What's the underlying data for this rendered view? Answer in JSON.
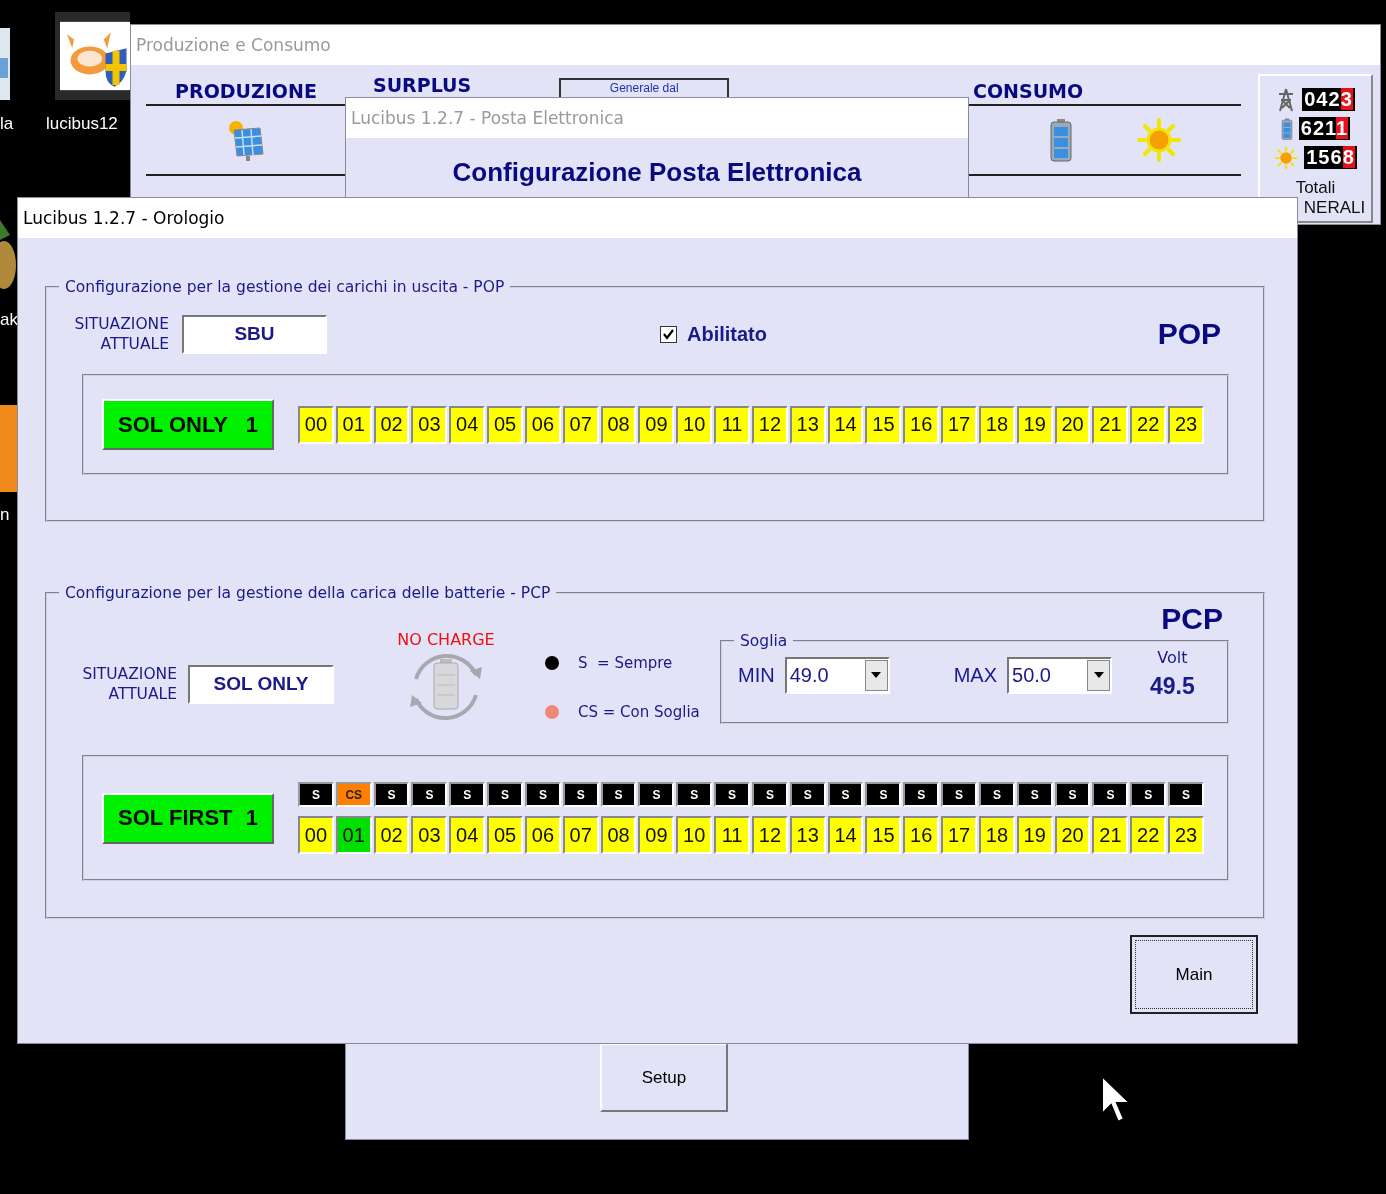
{
  "desktop": {
    "icons": [
      {
        "label": "la"
      },
      {
        "label": "lucibus12"
      },
      {
        "label": "ak"
      },
      {
        "label": "n"
      }
    ]
  },
  "produzione_window": {
    "title": "Produzione e Consumo",
    "headings": [
      "PRODUZIONE",
      "SURPLUS",
      "CONSUMO"
    ],
    "period_box": "Generale dal",
    "totals": {
      "counters": [
        {
          "kind": "grid",
          "value": "0423"
        },
        {
          "kind": "battery",
          "value": "6211"
        },
        {
          "kind": "solar",
          "value": "1568"
        }
      ],
      "label": "Totali",
      "label_2": "NERALI"
    }
  },
  "posta_window": {
    "title": "Lucibus 1.2.7 - Posta Elettronica",
    "heading": "Configurazione Posta Elettronica",
    "buttons": [
      "Setup"
    ]
  },
  "orologio_window": {
    "title": "Lucibus 1.2.7 - Orologio",
    "pop": {
      "legend": "Configurazione per la gestione dei carichi in uscita - POP",
      "status_label": "SITUAZIONE ATTUALE",
      "status_value": "SBU",
      "enabled": {
        "label": "Abilitato",
        "checked": true
      },
      "code": "POP",
      "program": {
        "label": "SOL ONLY",
        "number": "1"
      },
      "hours": [
        {
          "label": "00",
          "selected": false
        },
        {
          "label": "01",
          "selected": false
        },
        {
          "label": "02",
          "selected": false
        },
        {
          "label": "03",
          "selected": false
        },
        {
          "label": "04",
          "selected": false
        },
        {
          "label": "05",
          "selected": false
        },
        {
          "label": "06",
          "selected": false
        },
        {
          "label": "07",
          "selected": false
        },
        {
          "label": "08",
          "selected": false
        },
        {
          "label": "09",
          "selected": false
        },
        {
          "label": "10",
          "selected": false
        },
        {
          "label": "11",
          "selected": false
        },
        {
          "label": "12",
          "selected": false
        },
        {
          "label": "13",
          "selected": false
        },
        {
          "label": "14",
          "selected": false
        },
        {
          "label": "15",
          "selected": false
        },
        {
          "label": "16",
          "selected": false
        },
        {
          "label": "17",
          "selected": false
        },
        {
          "label": "18",
          "selected": false
        },
        {
          "label": "19",
          "selected": false
        },
        {
          "label": "20",
          "selected": false
        },
        {
          "label": "21",
          "selected": false
        },
        {
          "label": "22",
          "selected": false
        },
        {
          "label": "23",
          "selected": false
        }
      ]
    },
    "pcp": {
      "legend": "Configurazione per la gestione della carica delle batterie - PCP",
      "code": "PCP",
      "status_label": "SITUAZIONE ATTUALE",
      "status_value": "SOL ONLY",
      "charge_state": "NO CHARGE",
      "modes_legend": [
        {
          "label": "S  = Sempre",
          "color": "#000000"
        },
        {
          "label": "CS = Con Soglia",
          "color": "#f08878"
        }
      ],
      "threshold": {
        "legend": "Soglia",
        "min_label": "MIN",
        "min_value": "49.0",
        "max_label": "MAX",
        "max_value": "50.0",
        "volt_label": "Volt",
        "volt_value": "49.5"
      },
      "program": {
        "label": "SOL FIRST",
        "number": "1"
      },
      "slots": [
        {
          "mode": "S",
          "kind": "sempre",
          "hour": "00",
          "selected": false
        },
        {
          "mode": "CS",
          "kind": "soglia",
          "hour": "01",
          "selected": true
        },
        {
          "mode": "S",
          "kind": "sempre",
          "hour": "02",
          "selected": false
        },
        {
          "mode": "S",
          "kind": "sempre",
          "hour": "03",
          "selected": false
        },
        {
          "mode": "S",
          "kind": "sempre",
          "hour": "04",
          "selected": false
        },
        {
          "mode": "S",
          "kind": "sempre",
          "hour": "05",
          "selected": false
        },
        {
          "mode": "S",
          "kind": "sempre",
          "hour": "06",
          "selected": false
        },
        {
          "mode": "S",
          "kind": "sempre",
          "hour": "07",
          "selected": false
        },
        {
          "mode": "S",
          "kind": "sempre",
          "hour": "08",
          "selected": false
        },
        {
          "mode": "S",
          "kind": "sempre",
          "hour": "09",
          "selected": false
        },
        {
          "mode": "S",
          "kind": "sempre",
          "hour": "10",
          "selected": false
        },
        {
          "mode": "S",
          "kind": "sempre",
          "hour": "11",
          "selected": false
        },
        {
          "mode": "S",
          "kind": "sempre",
          "hour": "12",
          "selected": false
        },
        {
          "mode": "S",
          "kind": "sempre",
          "hour": "13",
          "selected": false
        },
        {
          "mode": "S",
          "kind": "sempre",
          "hour": "14",
          "selected": false
        },
        {
          "mode": "S",
          "kind": "sempre",
          "hour": "15",
          "selected": false
        },
        {
          "mode": "S",
          "kind": "sempre",
          "hour": "16",
          "selected": false
        },
        {
          "mode": "S",
          "kind": "sempre",
          "hour": "17",
          "selected": false
        },
        {
          "mode": "S",
          "kind": "sempre",
          "hour": "18",
          "selected": false
        },
        {
          "mode": "S",
          "kind": "sempre",
          "hour": "19",
          "selected": false
        },
        {
          "mode": "S",
          "kind": "sempre",
          "hour": "20",
          "selected": false
        },
        {
          "mode": "S",
          "kind": "sempre",
          "hour": "21",
          "selected": false
        },
        {
          "mode": "S",
          "kind": "sempre",
          "hour": "22",
          "selected": false
        },
        {
          "mode": "S",
          "kind": "sempre",
          "hour": "23",
          "selected": false
        }
      ]
    },
    "buttons": [
      "Main"
    ]
  }
}
